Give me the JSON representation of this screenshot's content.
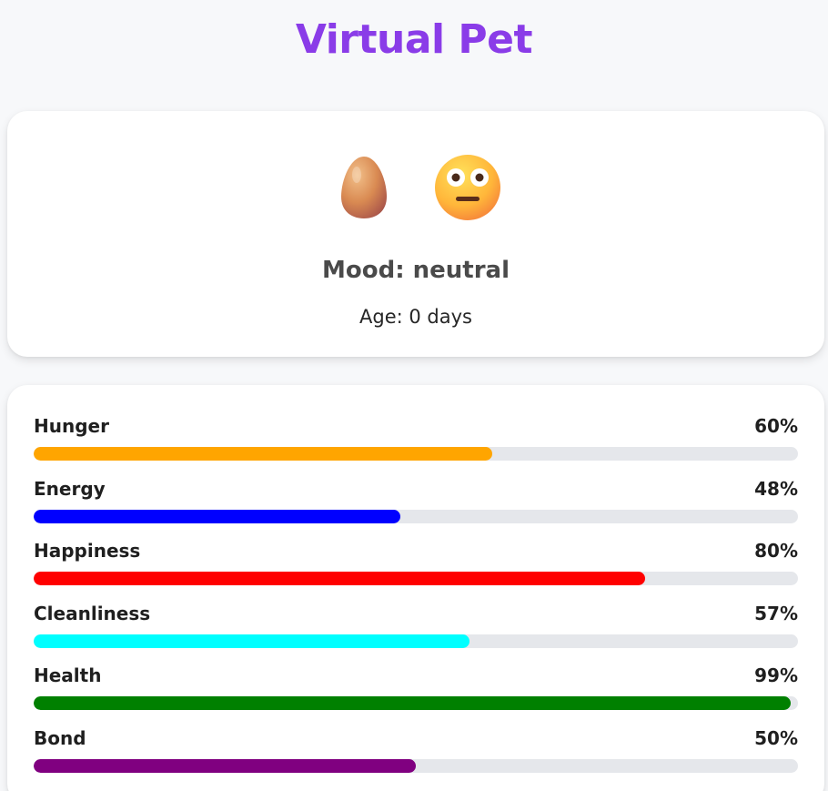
{
  "app": {
    "title": "Virtual Pet"
  },
  "pet": {
    "stage_icon": "egg-icon",
    "mood_icon": "neutral-face-icon",
    "mood_text": "Mood: neutral",
    "age_text": "Age: 0 days"
  },
  "stats": [
    {
      "label": "Hunger",
      "value_text": "60%",
      "value": 60,
      "color": "#ffa500"
    },
    {
      "label": "Energy",
      "value_text": "48%",
      "value": 48,
      "color": "#0000ff"
    },
    {
      "label": "Happiness",
      "value_text": "80%",
      "value": 80,
      "color": "#ff0000"
    },
    {
      "label": "Cleanliness",
      "value_text": "57%",
      "value": 57,
      "color": "#00ffff"
    },
    {
      "label": "Health",
      "value_text": "99%",
      "value": 99,
      "color": "#008000"
    },
    {
      "label": "Bond",
      "value_text": "50%",
      "value": 50,
      "color": "#800080"
    }
  ]
}
